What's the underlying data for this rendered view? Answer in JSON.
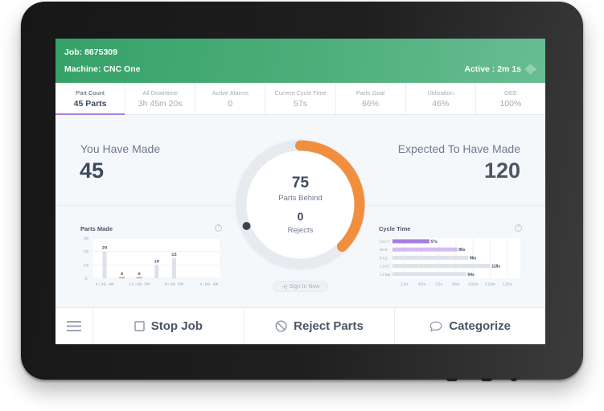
{
  "header": {
    "job_label": "Job: 8675309",
    "machine_label": "Machine: CNC One",
    "status_label": "Active : 2m 1s",
    "status_icon": "waveform-icon"
  },
  "tabs": [
    {
      "label": "Part Count",
      "value": "45 Parts",
      "active": true
    },
    {
      "label": "All Downtime",
      "value": "3h 45m 20s",
      "active": false
    },
    {
      "label": "Active Alarms",
      "value": "0",
      "active": false
    },
    {
      "label": "Current Cycle Time",
      "value": "57s",
      "active": false
    },
    {
      "label": "Parts Goal",
      "value": "66%",
      "active": false
    },
    {
      "label": "Utilization",
      "value": "46%",
      "active": false
    },
    {
      "label": "OEE",
      "value": "100%",
      "active": false
    }
  ],
  "main": {
    "made_label": "You Have Made",
    "made_value": "45",
    "expected_label": "Expected To Have Made",
    "expected_value": "120",
    "gauge": {
      "made": 45,
      "expected": 120,
      "marker_fraction": 0.69,
      "behind_value": "75",
      "behind_label": "Parts Behind",
      "rejects_value": "0",
      "rejects_label": "Rejects"
    },
    "sign_in_label": "Sign In Now",
    "sign_in_icon": "sign-in-icon"
  },
  "chart_data": [
    {
      "type": "bar",
      "title": "Parts Made",
      "help_icon": "?",
      "values": [
        20,
        0,
        0,
        10,
        15,
        null,
        null
      ],
      "x_tick_labels": [
        "4:30 AM",
        "12:00 PM",
        "8:00 PM",
        "4:00 AM"
      ],
      "x_tick_every": 2,
      "y_ticks": [
        0,
        10,
        20,
        30
      ],
      "ylim": [
        0,
        30
      ],
      "xlabel": "",
      "ylabel": "",
      "grid": true
    },
    {
      "type": "bar",
      "orientation": "horizontal",
      "title": "Cycle Time",
      "help_icon": "?",
      "categories": [
        "Curr",
        "Ave",
        "Exp",
        "Last",
        "LFew"
      ],
      "values": [
        57,
        85,
        96,
        118,
        94
      ],
      "value_labels": [
        "57s",
        "85s",
        "96s",
        "118s",
        "94s"
      ],
      "x_tick_labels": [
        "15s",
        "45s",
        "75s",
        "90s",
        "105s",
        "120s",
        "135s"
      ],
      "xlim": [
        20,
        148
      ],
      "grid": true
    }
  ],
  "actions": {
    "menu_icon": "hamburger-icon",
    "buttons": [
      {
        "label": "Stop Job",
        "icon": "square-icon"
      },
      {
        "label": "Reject Parts",
        "icon": "prohibited-icon"
      },
      {
        "label": "Categorize",
        "icon": "speech-bubble-icon"
      }
    ]
  },
  "colors": {
    "header_green": "#3fa871",
    "accent_purple": "#a57ee0",
    "light_purple": "#d4bcf2",
    "gauge_orange": "#f0903f",
    "text_dark": "#3d4960",
    "bar_gray": "#dde2ea"
  }
}
